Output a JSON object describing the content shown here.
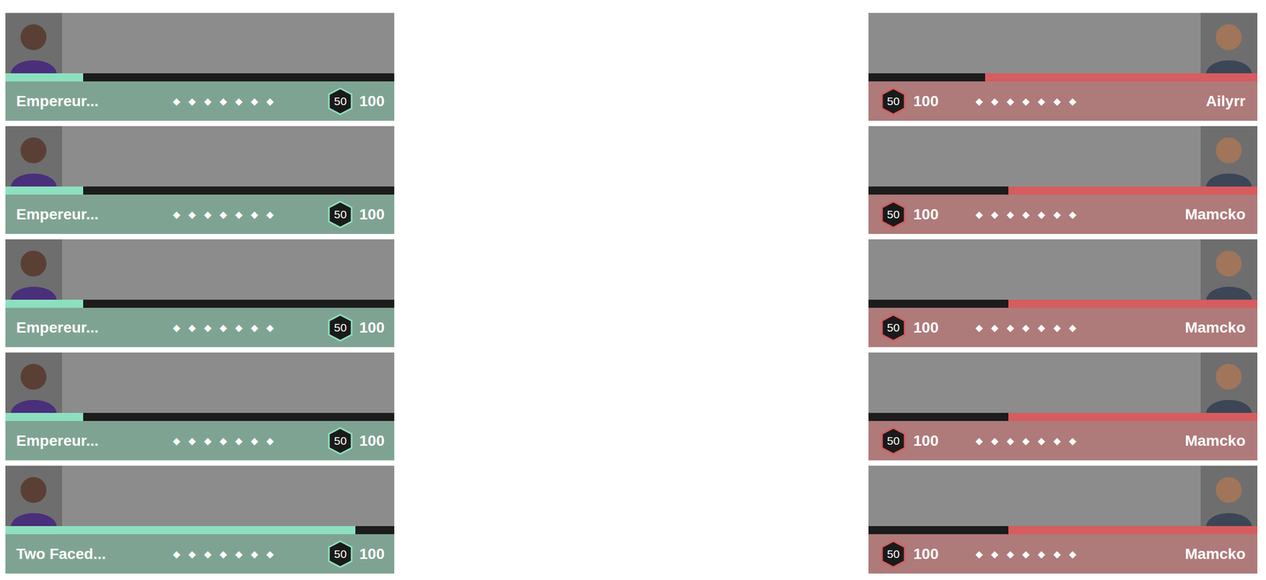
{
  "teams": [
    {
      "kind": "ally",
      "color": "#8de0bf",
      "players": [
        {
          "name": "Empereur...",
          "level": 0.2,
          "diamonds": "◆◆◆◆◆◆◆",
          "badge": "50",
          "score": "100"
        },
        {
          "name": "Empereur...",
          "level": 0.2,
          "diamonds": "◆◆◆◆◆◆◆",
          "badge": "50",
          "score": "100"
        },
        {
          "name": "Empereur...",
          "level": 0.2,
          "diamonds": "◆◆◆◆◆◆◆",
          "badge": "50",
          "score": "100"
        },
        {
          "name": "Empereur...",
          "level": 0.2,
          "diamonds": "◆◆◆◆◆◆◆",
          "badge": "50",
          "score": "100"
        },
        {
          "name": "Two Faced...",
          "level": 0.9,
          "diamonds": "◆◆◆◆◆◆◆",
          "badge": "50",
          "score": "100"
        }
      ]
    },
    {
      "kind": "enemy",
      "color": "#d65c5f",
      "players": [
        {
          "name": "Ailyrr",
          "level": 0.7,
          "diamonds": "◆◆◆◆◆◆◆",
          "badge": "50",
          "score": "100"
        },
        {
          "name": "Mamcko",
          "level": 0.64,
          "diamonds": "◆◆◆◆◆◆◆",
          "badge": "50",
          "score": "100"
        },
        {
          "name": "Mamcko",
          "level": 0.64,
          "diamonds": "◆◆◆◆◆◆◆",
          "badge": "50",
          "score": "100"
        },
        {
          "name": "Mamcko",
          "level": 0.64,
          "diamonds": "◆◆◆◆◆◆◆",
          "badge": "50",
          "score": "100"
        },
        {
          "name": "Mamcko",
          "level": 0.64,
          "diamonds": "◆◆◆◆◆◆◆",
          "badge": "50",
          "score": "100"
        }
      ]
    }
  ]
}
